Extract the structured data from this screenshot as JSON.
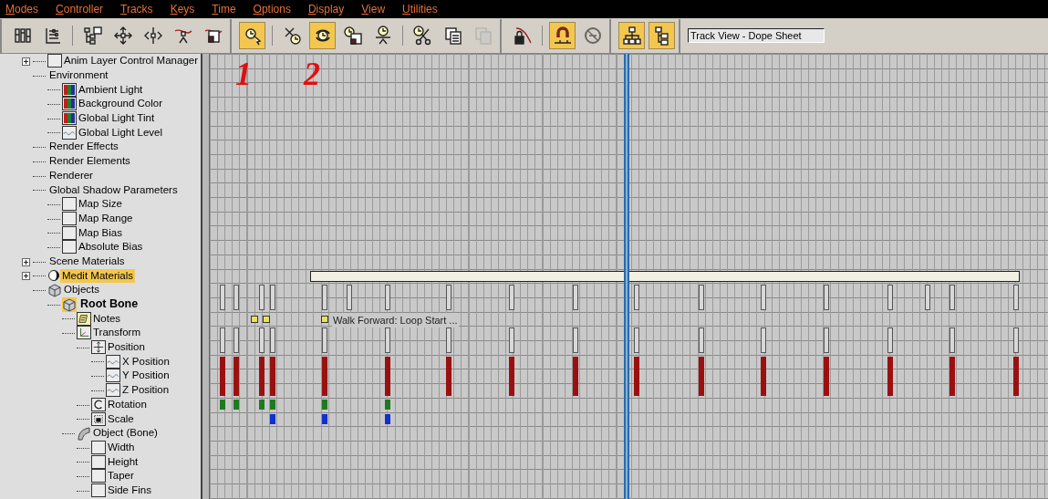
{
  "menu": [
    "Modes",
    "Controller",
    "Tracks",
    "Keys",
    "Time",
    "Options",
    "Display",
    "View",
    "Utilities"
  ],
  "toolbar": [
    {
      "buttons": [
        {
          "kind": "filter",
          "on": false,
          "disabled": false
        },
        {
          "kind": "outline",
          "on": false,
          "disabled": false
        },
        {
          "kind": "separator"
        },
        {
          "kind": "hierarchy",
          "on": false,
          "disabled": false
        },
        {
          "kind": "move",
          "on": false,
          "disabled": false
        },
        {
          "kind": "slide",
          "on": false,
          "disabled": false
        },
        {
          "kind": "addkey",
          "on": false,
          "disabled": false
        },
        {
          "kind": "drawkey",
          "on": false,
          "disabled": false
        }
      ]
    },
    {
      "buttons": [
        {
          "kind": "selecttime",
          "on": true,
          "disabled": false
        },
        {
          "kind": "separator"
        },
        {
          "kind": "deletetime",
          "on": false,
          "disabled": false
        },
        {
          "kind": "cycletime",
          "on": true,
          "disabled": false
        },
        {
          "kind": "scaletime",
          "on": false,
          "disabled": false
        },
        {
          "kind": "inserttime",
          "on": false,
          "disabled": false
        },
        {
          "kind": "separator"
        },
        {
          "kind": "cut",
          "on": false,
          "disabled": false
        },
        {
          "kind": "copy",
          "on": false,
          "disabled": false
        },
        {
          "kind": "paste",
          "on": false,
          "disabled": true
        }
      ]
    },
    {
      "buttons": [
        {
          "kind": "lock",
          "on": false,
          "disabled": false
        },
        {
          "kind": "separator"
        },
        {
          "kind": "snap",
          "on": true,
          "disabled": false
        },
        {
          "kind": "ignore",
          "on": false,
          "disabled": false
        }
      ]
    },
    {
      "buttons": [
        {
          "kind": "showall",
          "on": true,
          "disabled": false
        },
        {
          "kind": "showselected",
          "on": true,
          "disabled": false
        }
      ]
    }
  ],
  "view_name": "Track View - Dope Sheet",
  "callouts": [
    "1",
    "2"
  ],
  "time_slider": {
    "level": 0.497
  },
  "tree": [
    {
      "label": "Anim Layer Control Manager",
      "kind": "bracket",
      "selected": false,
      "collapsed": true
    },
    {
      "label": "Environment",
      "kind": "none",
      "selected": false,
      "children": [
        {
          "label": "Ambient Light",
          "kind": "color",
          "selected": false
        },
        {
          "label": "Background Color",
          "kind": "color",
          "selected": false
        },
        {
          "label": "Global Light Tint",
          "kind": "color",
          "selected": false
        },
        {
          "label": "Global Light Level",
          "kind": "curve",
          "selected": false
        }
      ]
    },
    {
      "label": "Render Effects",
      "kind": "none",
      "selected": false
    },
    {
      "label": "Render Elements",
      "kind": "none",
      "selected": false
    },
    {
      "label": "Renderer",
      "kind": "none",
      "selected": false
    },
    {
      "label": "Global Shadow Parameters",
      "kind": "none",
      "selected": false,
      "children": [
        {
          "label": "Map Size",
          "kind": "bracket",
          "selected": false
        },
        {
          "label": "Map Range",
          "kind": "bracket",
          "selected": false
        },
        {
          "label": "Map Bias",
          "kind": "bracket",
          "selected": false
        },
        {
          "label": "Absolute Bias",
          "kind": "bracket",
          "selected": false
        }
      ]
    },
    {
      "label": "Scene Materials",
      "kind": "none",
      "selected": false,
      "collapsed": true
    },
    {
      "label": "Medit Materials",
      "kind": "moon",
      "selected": true,
      "collapsed": true
    },
    {
      "label": "Objects",
      "kind": "cube",
      "selected": false,
      "children": [
        {
          "label": "Root Bone",
          "kind": "cube",
          "selected": false,
          "current": true,
          "children": [
            {
              "label": "Notes",
              "kind": "notes",
              "selected": false
            },
            {
              "label": "Transform",
              "kind": "transform",
              "selected": false,
              "children": [
                {
                  "label": "Position",
                  "kind": "position",
                  "selected": false,
                  "children": [
                    {
                      "label": "X Position",
                      "kind": "curve",
                      "selected": false
                    },
                    {
                      "label": "Y Position",
                      "kind": "curve",
                      "selected": false
                    },
                    {
                      "label": "Z Position",
                      "kind": "curve",
                      "selected": false
                    }
                  ]
                },
                {
                  "label": "Rotation",
                  "kind": "rotation",
                  "selected": false
                },
                {
                  "label": "Scale",
                  "kind": "scale",
                  "selected": false
                }
              ]
            },
            {
              "label": "Object (Bone)",
              "kind": "bone",
              "selected": false,
              "children": [
                {
                  "label": "Width",
                  "kind": "bracket",
                  "selected": false
                },
                {
                  "label": "Height",
                  "kind": "bracket",
                  "selected": false
                },
                {
                  "label": "Taper",
                  "kind": "bracket",
                  "selected": false
                },
                {
                  "label": "Side Fins",
                  "kind": "bracket",
                  "selected": false
                }
              ]
            }
          ]
        }
      ]
    }
  ],
  "note_label": "Walk Forward: Loop Start ..."
}
